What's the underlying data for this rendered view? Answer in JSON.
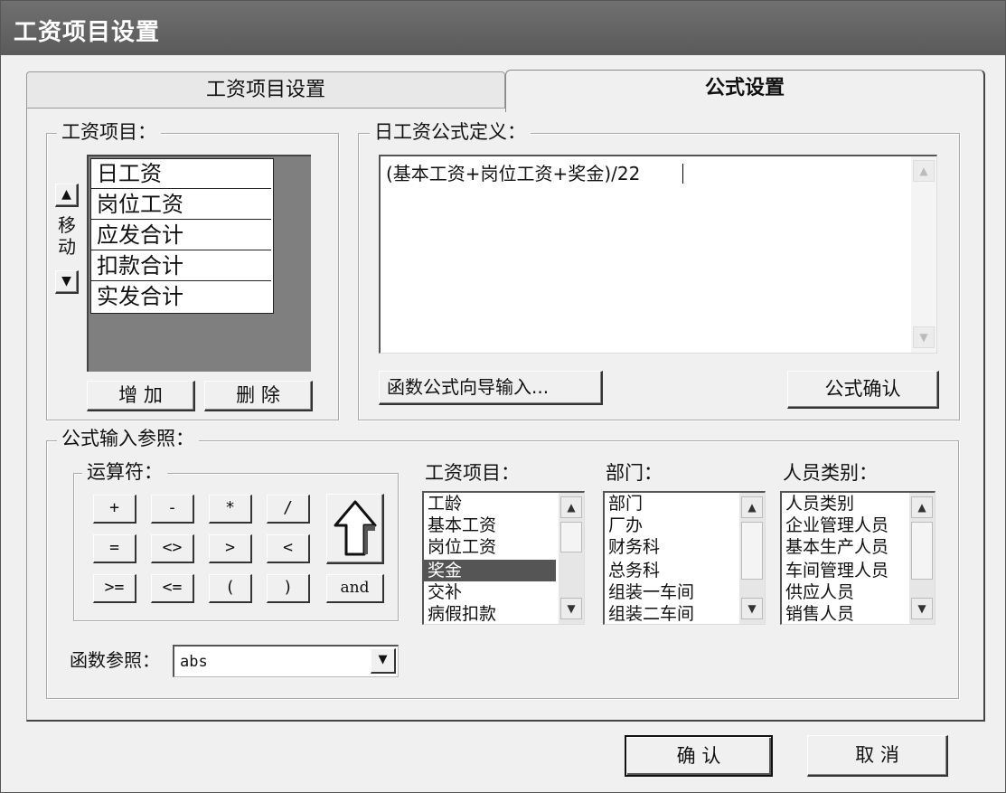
{
  "window": {
    "title": "工资项目设置"
  },
  "tabs": [
    {
      "label": "工资项目设置",
      "active": false
    },
    {
      "label": "公式设置",
      "active": true
    }
  ],
  "salary_items": {
    "label": "工资项目：",
    "move_label": "移动",
    "up_icon": "▲",
    "down_icon": "▼",
    "items": [
      "日工资",
      "岗位工资",
      "应发合计",
      "扣款合计",
      "实发合计"
    ],
    "add_label": "增 加",
    "delete_label": "删 除"
  },
  "formula_def": {
    "label": "日工资公式定义：",
    "text": "(基本工资+岗位工资+奖金)/22",
    "wizard_label": "函数公式向导输入...",
    "confirm_label": "公式确认"
  },
  "reference": {
    "label": "公式输入参照：",
    "operators_label": "运算符：",
    "operators": [
      "+",
      "-",
      "*",
      "/",
      "=",
      "<>",
      ">",
      "<",
      ">=",
      "<=",
      "(",
      ")"
    ],
    "and_label": "and",
    "insert_icon": "up-arrow-icon",
    "items_label": "工资项目：",
    "items": [
      "工龄",
      "基本工资",
      "岗位工资",
      "奖金",
      "交补",
      "病假扣款"
    ],
    "items_selected_index": 3,
    "dept_label": "部门：",
    "depts": [
      "部门",
      "厂办",
      "财务科",
      "总务科",
      "组装一车间",
      "组装二车间"
    ],
    "type_label": "人员类别：",
    "types": [
      "人员类别",
      "企业管理人员",
      "基本生产人员",
      "车间管理人员",
      "供应人员",
      "销售人员"
    ],
    "func_label": "函数参照：",
    "func_value": "abs"
  },
  "footer": {
    "ok_label": "确 认",
    "cancel_label": "取 消"
  }
}
